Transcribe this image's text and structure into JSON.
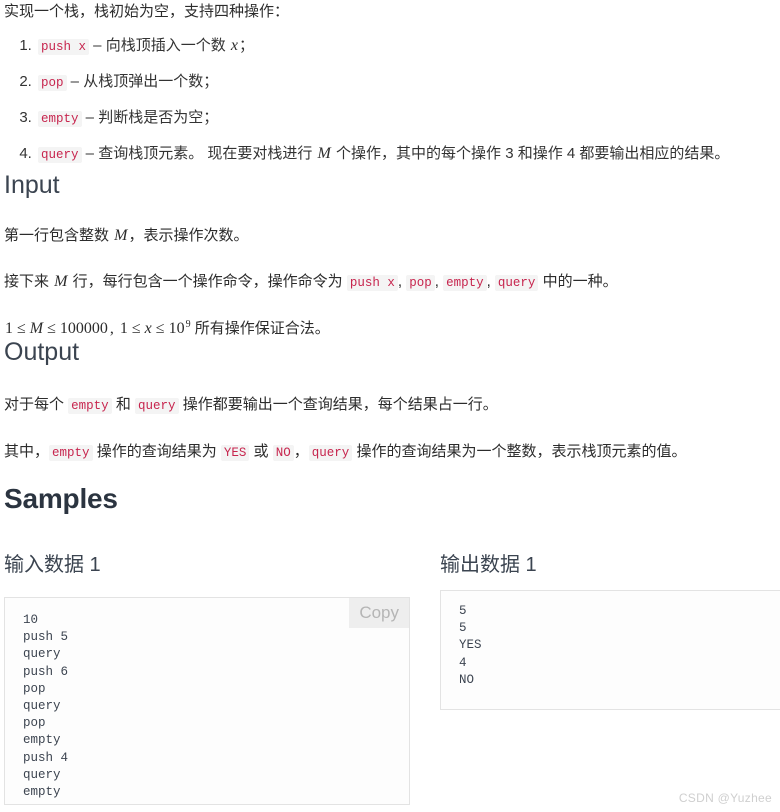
{
  "intro": {
    "lead": "实现一个栈，栈初始为空，支持四种操作："
  },
  "operations": [
    {
      "code": "push x",
      "desc_before": " – 向栈顶插入一个数 ",
      "math": "x",
      "desc_after": "；"
    },
    {
      "code": "pop",
      "desc_before": " – 从栈顶弹出一个数；",
      "math": "",
      "desc_after": ""
    },
    {
      "code": "empty",
      "desc_before": " – 判断栈是否为空；",
      "math": "",
      "desc_after": ""
    },
    {
      "code": "query",
      "desc_before": " – 查询栈顶元素。 现在要对栈进行 ",
      "math": "M",
      "desc_after": " 个操作，其中的每个操作 3 和操作 4 都要输出相应的结果。"
    }
  ],
  "input_section": {
    "heading": "Input",
    "line1_a": "第一行包含整数 ",
    "line1_math": "M",
    "line1_b": "，表示操作次数。",
    "line2_a": "接下来 ",
    "line2_math": "M",
    "line2_b": " 行，每行包含一个操作命令，操作命令为 ",
    "line2_codes": [
      "push x",
      "pop",
      "empty",
      "query"
    ],
    "line2_sep": ", ",
    "line2_c": " 中的一种。",
    "constraint": {
      "one": "1",
      "le1": "≤",
      "m": "M",
      "le2": "≤",
      "max_m": "100000",
      "comma": ", ",
      "one2": "1",
      "le3": "≤",
      "x": "x",
      "le4": "≤",
      "base": "10",
      "exp": "9",
      "tail": " 所有操作保证合法。"
    }
  },
  "output_section": {
    "heading": "Output",
    "line1_a": "对于每个 ",
    "line1_code1": "empty",
    "line1_b": " 和 ",
    "line1_code2": "query",
    "line1_c": " 操作都要输出一个查询结果，每个结果占一行。",
    "line2_a": "其中，",
    "line2_code1": "empty",
    "line2_b": " 操作的查询结果为 ",
    "line2_code2": "YES",
    "line2_c": " 或 ",
    "line2_code3": "NO",
    "line2_d": "，",
    "line2_code4": "query",
    "line2_e": " 操作的查询结果为一个整数，表示栈顶元素的值。"
  },
  "samples": {
    "heading": "Samples",
    "input_title": "输入数据 1",
    "output_title": "输出数据 1",
    "copy_label": "Copy",
    "input_code": "10\npush 5\nquery\npush 6\npop\nquery\npop\nempty\npush 4\nquery\nempty",
    "output_code": "5\n5\nYES\n4\nNO"
  },
  "watermark": "CSDN @Yuzhee",
  "colors": {
    "inline_code_text": "#c7254e",
    "inline_code_bg": "#f4f4f4",
    "heading": "#3b4450",
    "code_text": "#3c4450",
    "border": "#e3e3e3",
    "copy_bg": "#eeeeee",
    "watermark": "#cfcfcf"
  }
}
